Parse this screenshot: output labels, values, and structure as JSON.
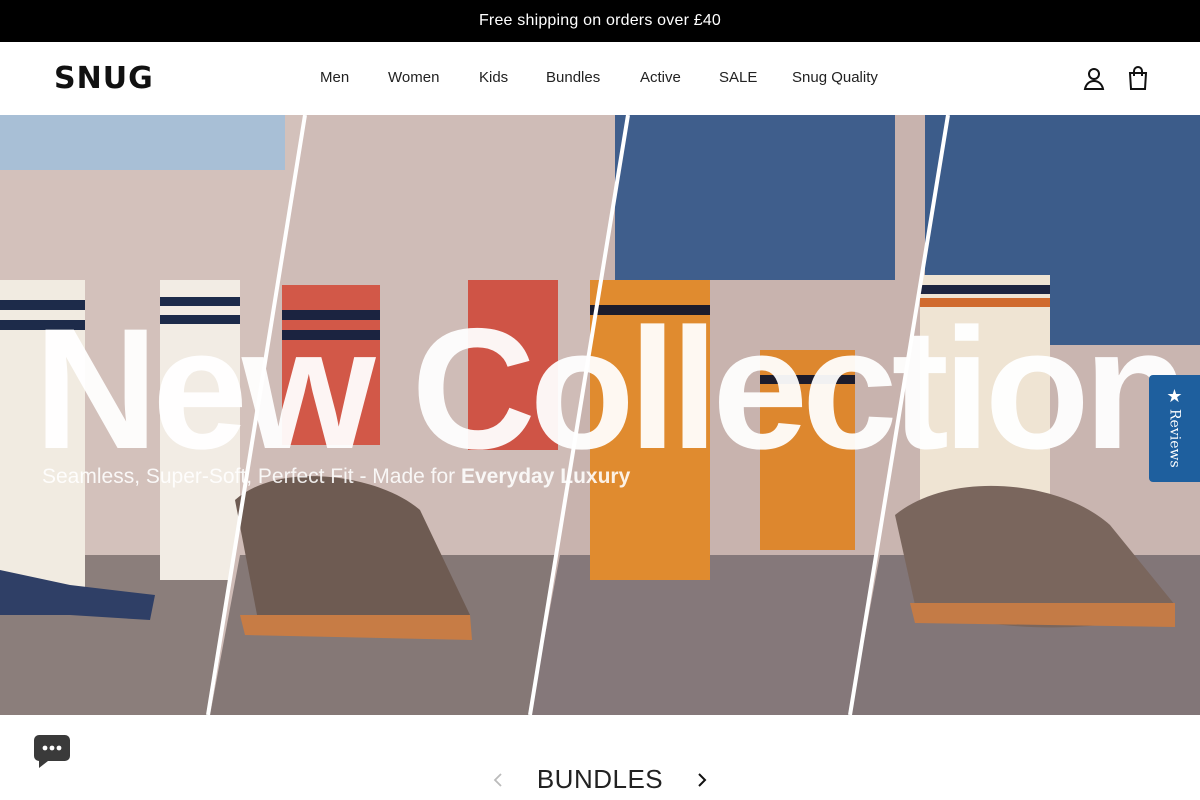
{
  "announcement": {
    "text": "Free shipping on orders over £40"
  },
  "header": {
    "logo": "SNUG",
    "nav": [
      "Men",
      "Women",
      "Kids",
      "Bundles",
      "Active",
      "SALE",
      "Snug Quality"
    ],
    "icons": [
      "account-icon",
      "cart-icon"
    ]
  },
  "hero": {
    "title": "New Collection",
    "subtitle_regular": "Seamless, Super-Soft, Perfect Fit - Made for ",
    "subtitle_bold": "Everyday Luxury"
  },
  "reviews_tab": {
    "label": "Reviews",
    "icon": "star-icon"
  },
  "chat": {
    "icon": "chat-icon"
  },
  "bundles": {
    "title": "BUNDLES",
    "prev_icon": "chevron-left-icon",
    "next_icon": "chevron-right-icon"
  },
  "colors": {
    "announcement_bg": "#000000",
    "reviews_tab": "#1e5f9e",
    "chat_button": "#3a3a3a"
  }
}
